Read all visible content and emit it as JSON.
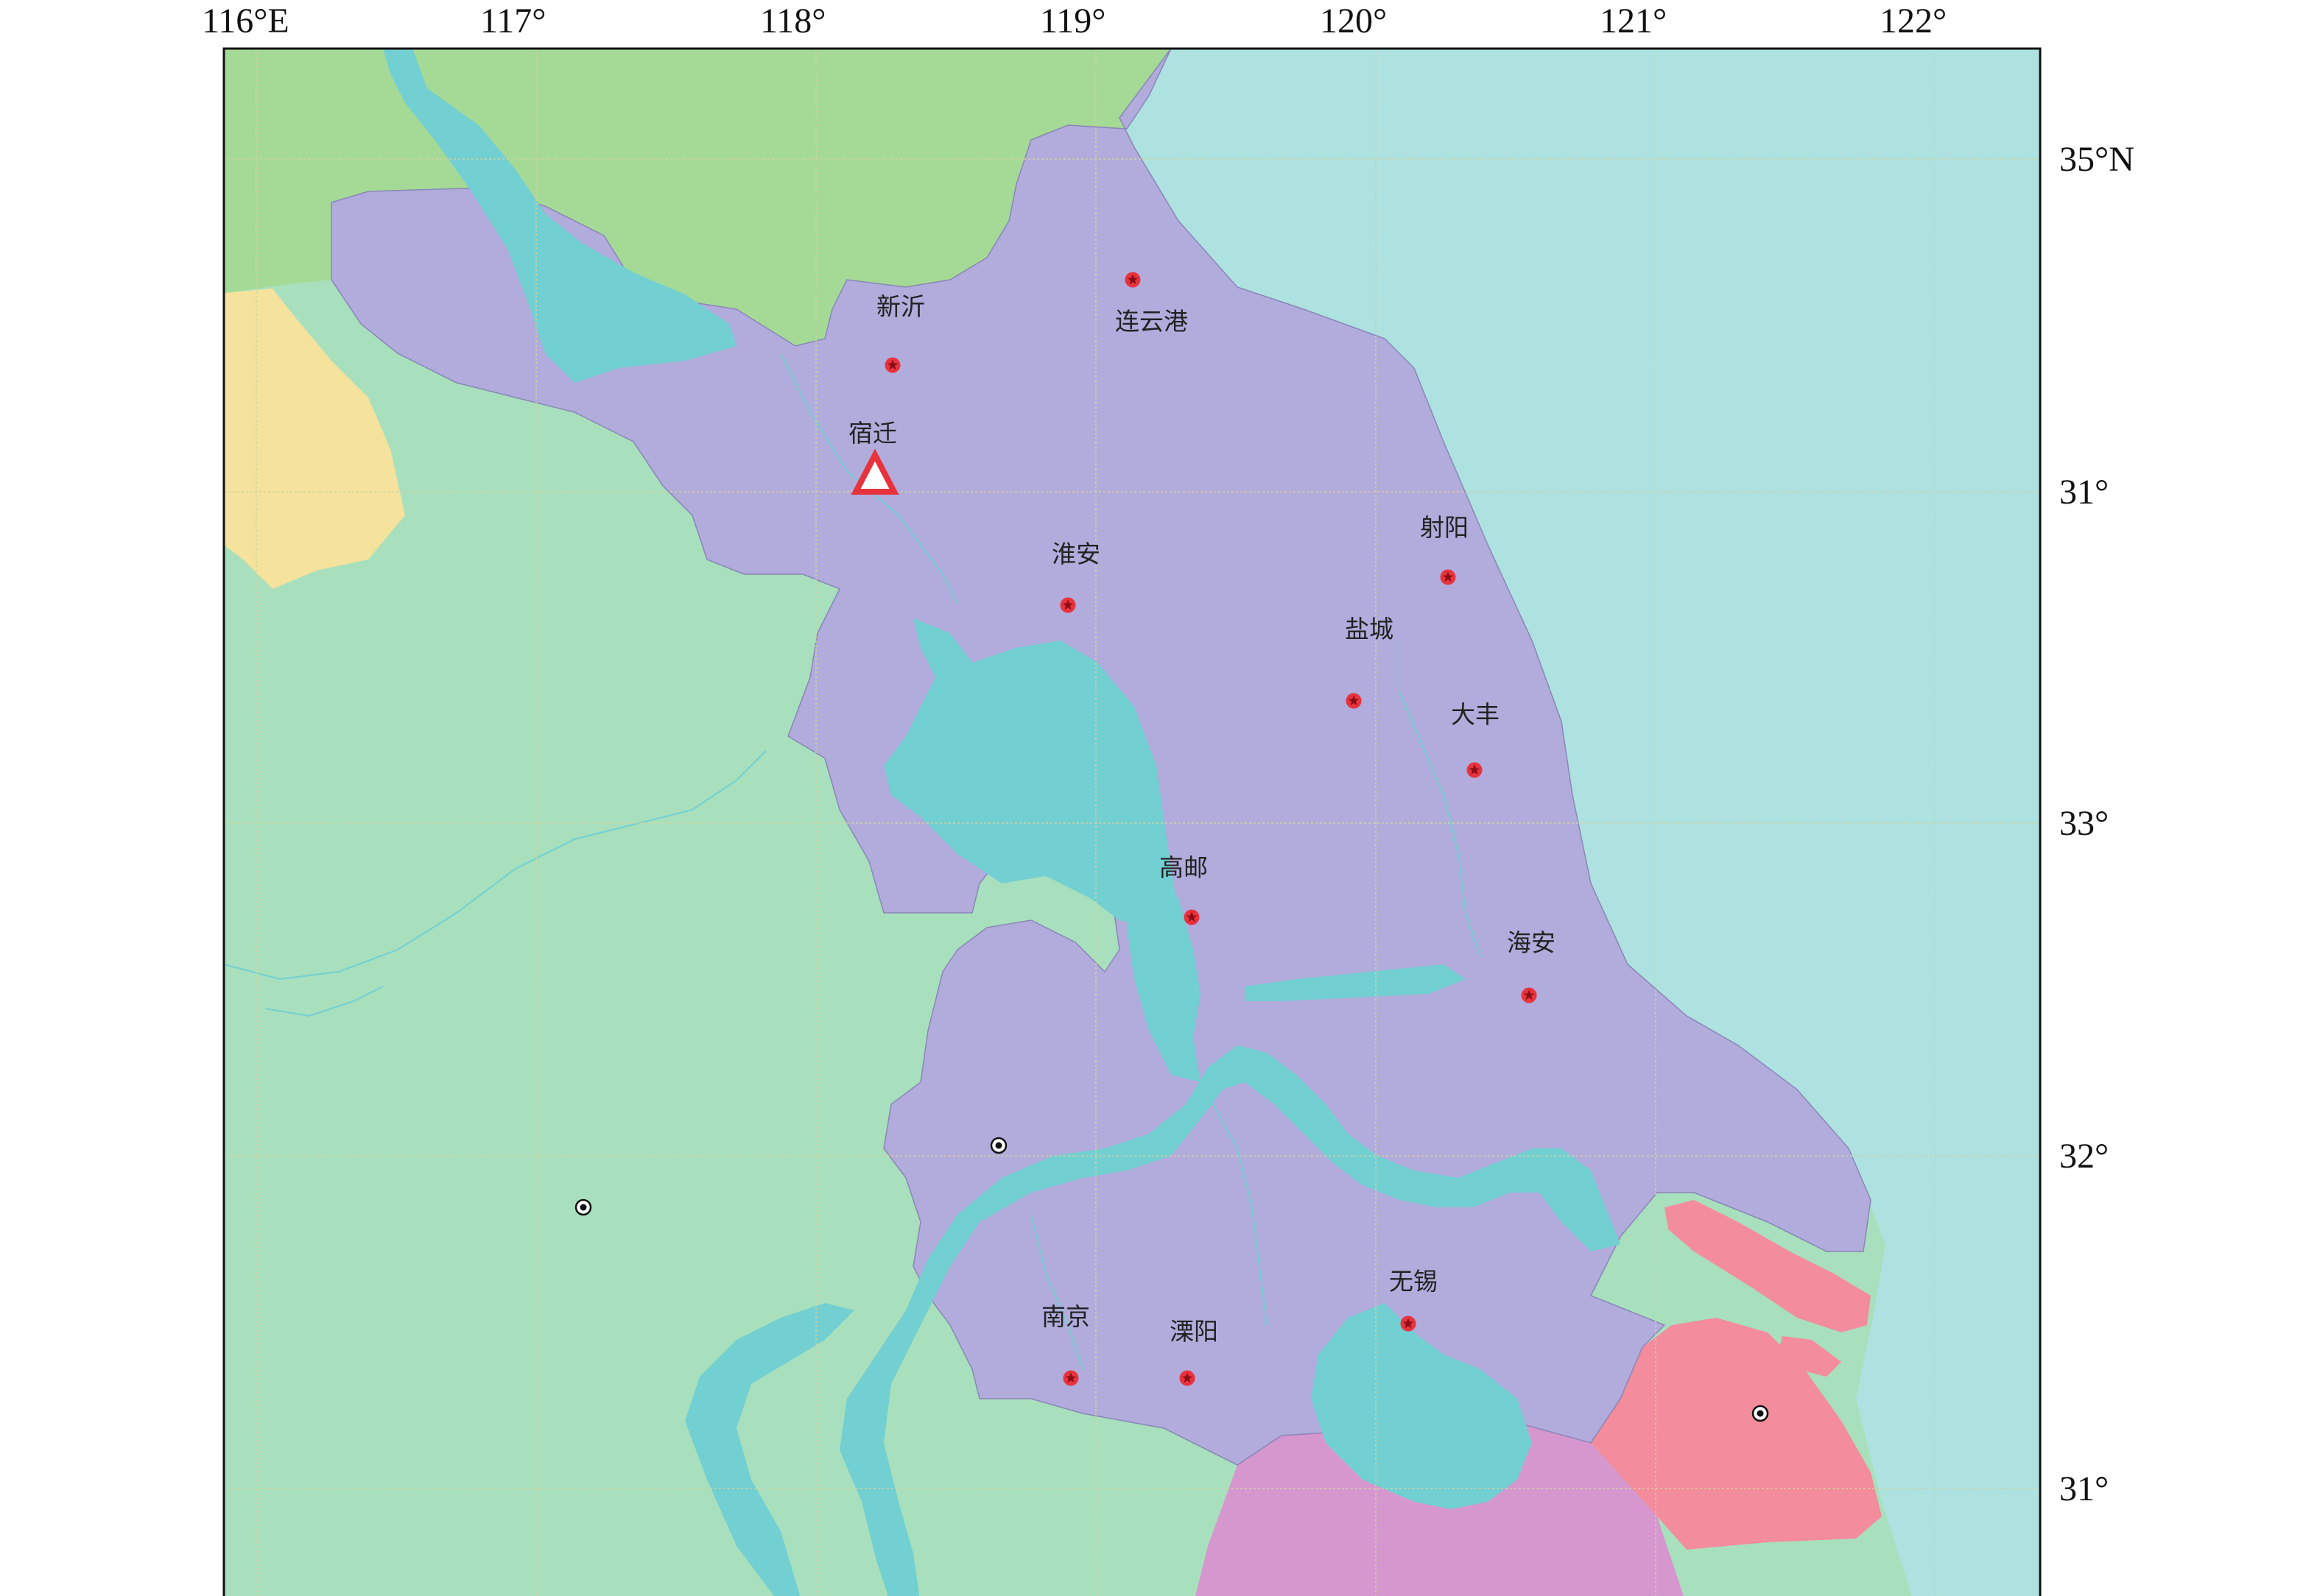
{
  "map": {
    "axis": {
      "top_ticks": [
        "116°E",
        "117°",
        "118°",
        "119°",
        "120°",
        "121°",
        "122°"
      ],
      "right_ticks": [
        "35°N",
        "31°",
        "33°",
        "32°",
        "31°"
      ]
    },
    "cities": [
      {
        "name": "新沂",
        "marker": "red-star-circle"
      },
      {
        "name": "连云港",
        "marker": "red-star-circle"
      },
      {
        "name": "宿迁",
        "marker": "red-triangle"
      },
      {
        "name": "淮安",
        "marker": "red-star-circle"
      },
      {
        "name": "射阳",
        "marker": "red-star-circle"
      },
      {
        "name": "盐城",
        "marker": "red-star-circle"
      },
      {
        "name": "大丰",
        "marker": "red-star-circle"
      },
      {
        "name": "高邮",
        "marker": "red-star-circle"
      },
      {
        "name": "海安",
        "marker": "red-star-circle"
      },
      {
        "name": "无锡",
        "marker": "red-star-circle"
      },
      {
        "name": "南京",
        "marker": "red-star-circle"
      },
      {
        "name": "溧阳",
        "marker": "red-star-circle"
      }
    ],
    "colors": {
      "jiangsu": "#b1acdc",
      "shandong": "#a5da96",
      "anhui": "#a8e0bd",
      "henan": "#f5e29d",
      "zhejiang": "#d697cf",
      "shanghai": "#f38c9c",
      "sea": "#ade2e0",
      "water": "#72cfd2",
      "marker": "#e8323c",
      "grid": "#d2d2a0"
    }
  }
}
